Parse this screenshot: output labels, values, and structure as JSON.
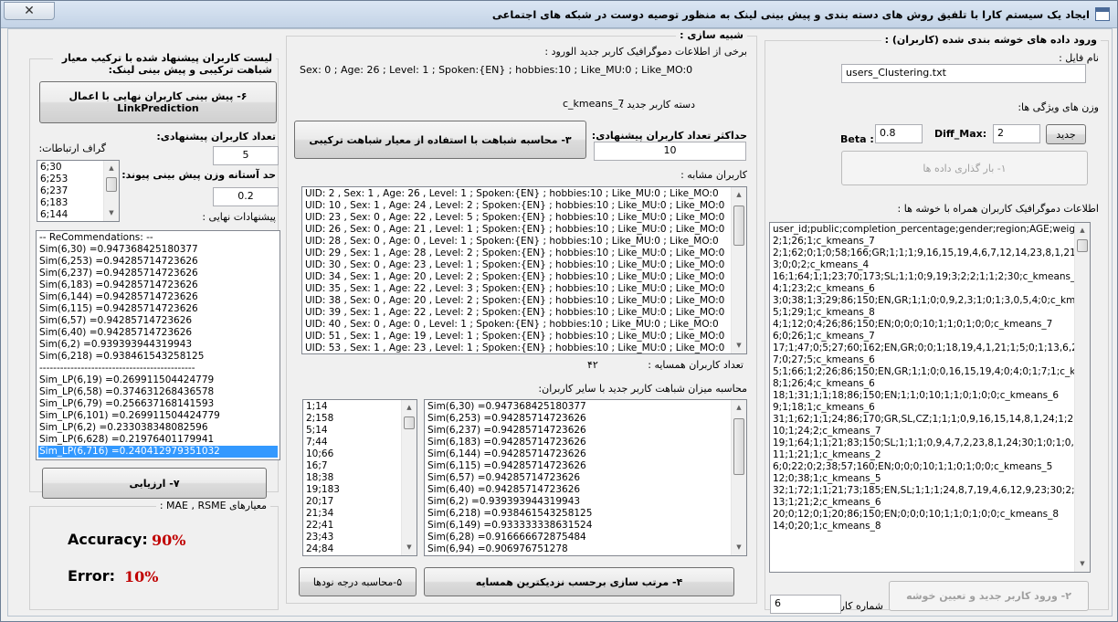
{
  "window": {
    "title": "ایجاد یک سیستم کارا با تلفیق روش های دسته بندی و پیش بینی لینک به منظور توصیه دوست در شبکه های اجتماعی",
    "close_glyph": "✕"
  },
  "right_group": {
    "title": "ورود داده های خوشه بندی شده (کاربران) :",
    "file_label": "نام فایل :",
    "file_value": "users_Clustering.txt",
    "weights_label": "وزن های ویژگی ها:",
    "beta_label": "Beta :",
    "beta_value": "0.8",
    "diffmax_label": "Diff_Max:",
    "diffmax_value": "2",
    "new_button": "جدید",
    "load_button": "۱- بار گذاری داده ها",
    "info_label": "اطلاعات دموگرافیک کاربران همراه با خوشه ها :",
    "data_lines": [
      "user_id;public;completion_percentage;gender;region;AGE;weight;hei",
      "2;1;26;1;c_kmeans_7",
      "2;1;62;0;1;0;58;166;GR;1;1;1;9,16,15,19,4,6,7,12,14,23,8,1,21;1;",
      "3;0;0;2;c_kmeans_4",
      "16;1;64;1;1;23;70;173;SL;1;1;0;9,19;3;2;2;1;1;2;30;c_kmeans_6",
      "4;1;23;2;c_kmeans_6",
      "3;0;38;1;3;29;86;150;EN,GR;1;1;0;0,9,2,3;1;0;1;3,0,5,4;0;c_kmea",
      "5;1;29;1;c_kmeans_8",
      "4;1;12;0;4;26;86;150;EN;0;0;0;10;1;1;0;1;0;0;c_kmeans_7",
      "6;0;26;1;c_kmeans_7",
      "17;1;47;0;5;27;60;162;EN,GR;0;0;1;18,19,4,1,21;1;5;0;1;13,6,2,7",
      "7;0;27;5;c_kmeans_6",
      "5;1;66;1;2;26;86;150;EN,GR;1;1;0;0,16,15,19,4;0;4;0;1;7;1;c_kme",
      "8;1;26;4;c_kmeans_6",
      "18;1;31;1;1;18;86;150;EN;1;1;0;10;1;1;0;1;0;0;c_kmeans_6",
      "9;1;18;1;c_kmeans_6",
      "31;1;62;1;1;24;86;170;GR,SL,CZ;1;1;1;0,9,16,15,14,8,1,24;1;2;1;0",
      "10;1;24;2;c_kmeans_7",
      "19;1;64;1;1;21;83;150;SL;1;1;1;0,9,4,7,2,23,8,1,24;30;1;0;1;0,3;0",
      "11;1;21;1;c_kmeans_2",
      "6;0;22;0;2;38;57;160;EN;0;0;0;10;1;1;0;1;0;0;c_kmeans_5",
      "12;0;38;1;c_kmeans_5",
      "32;1;72;1;1;21;73;185;EN,SL;1;1;1;24,8,7,19,4,6,12,9,23;30;2;2;0",
      "13;1;21;2;c_kmeans_6",
      "20;0;12;0;1;20;86;150;EN;0;0;0;10;1;1;0;1;0;0;c_kmeans_8",
      "14;0;20;1;c_kmeans_8"
    ],
    "new_user_button": "۲- ورود کاربر جدید و تعیین خوشه",
    "user_no_label": "شماره کاربر:",
    "user_no_value": "6"
  },
  "middle_group": {
    "title": "شبیه سازی :",
    "demo_label": "برخی از اطلاعات دموگرافیک کاربر جدید الورود :",
    "demo_text": "Sex: 0 ; Age: 26 ; Level: 1 ; Spoken:{EN} ; hobbies:10 ; Like_MU:0 ; Like_MO:0",
    "cluster_label": "دسته کاربر جدید :",
    "cluster_value": "c_kmeans_7",
    "max_label": "حداکثر تعداد کاربران پیشنهادی:",
    "max_value": "10",
    "calc_button": "۳- محاسبه شباهت با استفاده از معیار شباهت ترکیبی",
    "similar_label": "کاربران مشابه :",
    "similar_users": [
      "UID: 2 , Sex: 1 , Age: 26 , Level: 1 ; Spoken:{EN} ; hobbies:10 ; Like_MU:0 ; Like_MO:0",
      "UID: 10 , Sex: 1 , Age: 24 , Level: 2 ; Spoken:{EN} ; hobbies:10 ; Like_MU:0 ; Like_MO:0",
      "UID: 23 , Sex: 0 , Age: 22 , Level: 5 ; Spoken:{EN} ; hobbies:10 ; Like_MU:0 ; Like_MO:0",
      "UID: 26 , Sex: 0 , Age: 21 , Level: 1 ; Spoken:{EN} ; hobbies:10 ; Like_MU:0 ; Like_MO:0",
      "UID: 28 , Sex: 0 , Age: 0 , Level: 1 ; Spoken:{EN} ; hobbies:10 ; Like_MU:0 ; Like_MO:0",
      "UID: 29 , Sex: 1 , Age: 28 , Level: 2 ; Spoken:{EN} ; hobbies:10 ; Like_MU:0 ; Like_MO:0",
      "UID: 30 , Sex: 0 , Age: 23 , Level: 1 ; Spoken:{EN} ; hobbies:10 ; Like_MU:0 ; Like_MO:0",
      "UID: 34 , Sex: 1 , Age: 20 , Level: 2 ; Spoken:{EN} ; hobbies:10 ; Like_MU:0 ; Like_MO:0",
      "UID: 35 , Sex: 1 , Age: 22 , Level: 3 ; Spoken:{EN} ; hobbies:10 ; Like_MU:0 ; Like_MO:0",
      "UID: 38 , Sex: 0 , Age: 20 , Level: 2 ; Spoken:{EN} ; hobbies:10 ; Like_MU:0 ; Like_MO:0",
      "UID: 39 , Sex: 1 , Age: 22 , Level: 2 ; Spoken:{EN} ; hobbies:10 ; Like_MU:0 ; Like_MO:0",
      "UID: 40 , Sex: 0 , Age: 0 , Level: 1 ; Spoken:{EN} ; hobbies:10 ; Like_MU:0 ; Like_MO:0",
      "UID: 51 , Sex: 1 , Age: 19 , Level: 1 ; Spoken:{EN} ; hobbies:10 ; Like_MU:0 ; Like_MO:0",
      "UID: 53 , Sex: 1 , Age: 23 , Level: 1 ; Spoken:{EN} ; hobbies:10 ; Like_MU:0 ; Like_MO:0"
    ],
    "neighbors_label": "تعداد کاربران همسایه :",
    "neighbors_value": "۴۲",
    "sim_label": "محاسبه میزان شباهت کاربر جدید با سایر کاربران:",
    "degree_list": [
      "1;14",
      "2;158",
      "5;14",
      "7;44",
      "10;66",
      "16;7",
      "18;38",
      "19;183",
      "20;17",
      "21;34",
      "22;41",
      "23;43",
      "24;84"
    ],
    "sim_list": [
      "Sim(6,30) =0.947368425180377",
      "Sim(6,253) =0.94285714723626",
      "Sim(6,237) =0.94285714723626",
      "Sim(6,183) =0.94285714723626",
      "Sim(6,144) =0.94285714723626",
      "Sim(6,115) =0.94285714723626",
      "Sim(6,57) =0.94285714723626",
      "Sim(6,40) =0.94285714723626",
      "Sim(6,2) =0.939393944319943",
      "Sim(6,218) =0.938461543258125",
      "Sim(6,149) =0.933333338631524",
      "Sim(6,28) =0.916666672875484",
      "Sim(6,94) =0.906976751278"
    ],
    "degree_button": "۵-محاسبه درجه نودها",
    "sort_button": "۴- مرتب سازی برحسب نزدیکترین همسایه"
  },
  "left_group": {
    "title": "لیست کاربران پیشنهاد شده با ترکیب معیار شباهت ترکیبی و پیش بینی لینک:",
    "predict_button": "۶- پیش بینی کاربران نهایی با اعمال LinkPrediction",
    "suggest_label": "تعداد کاربران پیشنهادی:",
    "suggest_value": "5",
    "graph_label": "گراف ارتباطات:",
    "graph_items": [
      "6;30",
      "6;253",
      "6;237",
      "6;183",
      "6;144"
    ],
    "threshold_label": "حد آستانه وزن پیش بینی پیوند:",
    "threshold_value": "0.2",
    "final_label": "پیشنهادات نهایی :",
    "final_items": [
      "-- ReCommendations: --",
      "Sim(6,30) =0.947368425180377",
      "Sim(6,253) =0.94285714723626",
      "Sim(6,237) =0.94285714723626",
      "Sim(6,183) =0.94285714723626",
      "Sim(6,144) =0.94285714723626",
      "Sim(6,115) =0.94285714723626",
      "Sim(6,57) =0.94285714723626",
      "Sim(6,40) =0.94285714723626",
      "Sim(6,2) =0.939393944319943",
      "Sim(6,218) =0.938461543258125",
      "---------------------------------------------",
      "Sim_LP(6,19) =0.269911504424779",
      "Sim_LP(6,58) =0.374631268436578",
      "Sim_LP(6,79) =0.256637168141593",
      "Sim_LP(6,101) =0.269911504424779",
      "Sim_LP(6,2) =0.233038348082596",
      "Sim_LP(6,628) =0.21976401179941",
      "Sim_LP(6,716) =0.240412979351032"
    ],
    "eval_button": "۷- ارزیابی",
    "metrics_title": "معیارهای MAE , RSME :",
    "accuracy_label": "Accuracy:",
    "accuracy_value": "90%",
    "error_label": "Error:",
    "error_value": "10%"
  },
  "colors": {
    "accent_red": "#c00000",
    "selection": "#3399ff"
  }
}
